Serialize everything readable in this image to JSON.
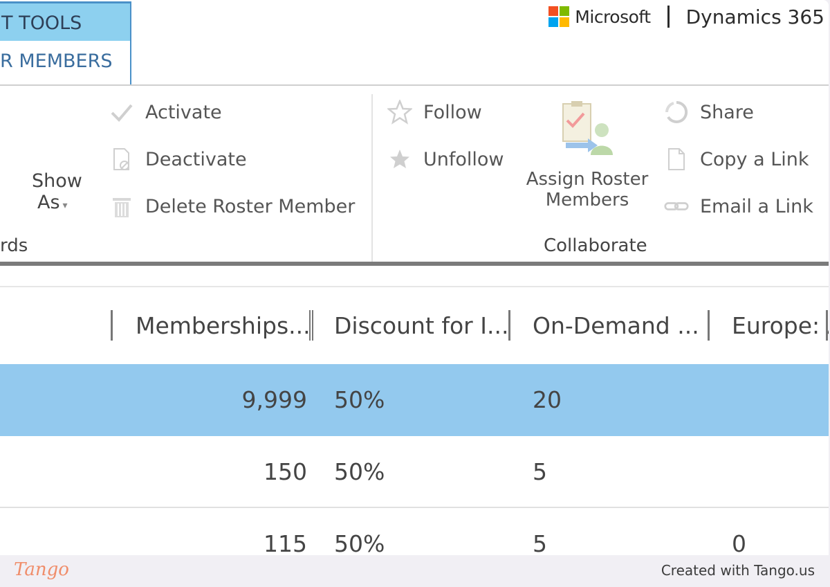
{
  "tabs": {
    "context_group": "T TOOLS",
    "active_tab": "R MEMBERS"
  },
  "brand": {
    "company": "Microsoft",
    "product": "Dynamics 365",
    "logo_colors": [
      "#f25022",
      "#7fba00",
      "#00a4ef",
      "#ffb900"
    ]
  },
  "ribbon": {
    "records_group_label": "rds",
    "show_as": {
      "line1": "Show",
      "line2": "As"
    },
    "activate": "Activate",
    "deactivate": "Deactivate",
    "delete": "Delete Roster Member",
    "follow": "Follow",
    "unfollow": "Unfollow",
    "assign": {
      "line1": "Assign Roster",
      "line2": "Members"
    },
    "share": "Share",
    "copy_link": "Copy a Link",
    "email_link": "Email a Link",
    "collaborate_label": "Collaborate"
  },
  "grid": {
    "columns": [
      "Memberships...",
      "Discount for I...",
      "On-Demand ...",
      "Europe: A"
    ],
    "rows": [
      {
        "memberships": "9,999",
        "discount": "50%",
        "ondemand": "20",
        "europe": ""
      },
      {
        "memberships": "150",
        "discount": "50%",
        "ondemand": "5",
        "europe": ""
      },
      {
        "memberships": "115",
        "discount": "50%",
        "ondemand": "5",
        "europe": "0"
      }
    ],
    "selected_row_color": "#93c9ee"
  },
  "footer": {
    "logo": "Tango",
    "credit": "Created with Tango.us"
  }
}
